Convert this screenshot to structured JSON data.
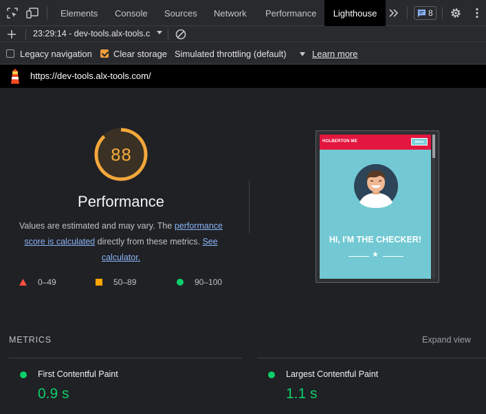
{
  "tabs": [
    {
      "label": "Elements",
      "active": false
    },
    {
      "label": "Console",
      "active": false
    },
    {
      "label": "Sources",
      "active": false
    },
    {
      "label": "Network",
      "active": false
    },
    {
      "label": "Performance",
      "active": false
    },
    {
      "label": "Lighthouse",
      "active": true
    }
  ],
  "issues_badge": {
    "count": "8",
    "icon": "message-icon"
  },
  "toolbar": {
    "report": "23:29:14 - dev-tools.alx-tools.c",
    "new_report_icon": "plus-icon",
    "clear_icon": "block-icon"
  },
  "options": {
    "legacy_navigation": {
      "label": "Legacy navigation",
      "checked": false
    },
    "clear_storage": {
      "label": "Clear storage",
      "checked": true
    },
    "throttling": "Simulated throttling (default)",
    "learn_more": "Learn more"
  },
  "url": "https://dev-tools.alx-tools.com/",
  "score": {
    "value": 88,
    "category": "Performance",
    "desc_pre": "Values are estimated and may vary. The ",
    "desc_link1": "performance score is calculated",
    "desc_mid": " directly from these metrics. ",
    "desc_link2": "See calculator."
  },
  "legend": [
    {
      "range": "0–49",
      "color": "#ff4e42",
      "shape": "triangle"
    },
    {
      "range": "50–89",
      "color": "#ffa400",
      "shape": "square"
    },
    {
      "range": "90–100",
      "color": "#0cce6b",
      "shape": "circle"
    }
  ],
  "screenshot": {
    "brand": "HOLBERTON ME",
    "menu": "MENU",
    "hero": "HI, I'M THE CHECKER!"
  },
  "metrics": {
    "label": "METRICS",
    "expand": "Expand view",
    "items": [
      {
        "name": "First Contentful Paint",
        "value": "0.9 s",
        "color": "#0cce6b"
      },
      {
        "name": "Largest Contentful Paint",
        "value": "1.1 s",
        "color": "#0cce6b"
      }
    ]
  },
  "colors": {
    "accent": "#f4a73b",
    "good": "#0cce6b",
    "link": "#8ab4f8"
  }
}
